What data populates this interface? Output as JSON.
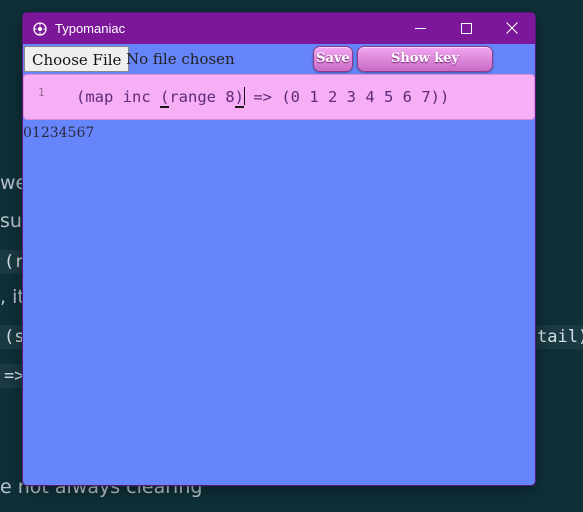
{
  "window": {
    "title": "Typomaniac",
    "controls": {
      "minimize_icon": "minimize-icon",
      "maximize_icon": "maximize-icon",
      "close_icon": "close-icon"
    }
  },
  "toolbar": {
    "file_button_label": "Choose File",
    "file_status": "No file chosen",
    "save_label": "Save",
    "keybindings_label": "Show key bindings"
  },
  "editor": {
    "line_number": "1",
    "code_before": "(map inc ",
    "open_paren": "(",
    "code_middle": "range 8",
    "close_paren": ")",
    "code_after": " => (0 1 2 3 4 5 6 7))"
  },
  "output": {
    "text": "01234567"
  },
  "background": {
    "frag1": "wel",
    "frag2": "su",
    "frag3": "(r",
    "frag4": ", it",
    "frag5": "(s",
    "frag6": "tail)",
    "frag7": "=>",
    "frag8": "e not always clearing"
  },
  "colors": {
    "titlebar": "#7d179a",
    "window_bg": "#6785fb",
    "editor_bg": "#f6aef5",
    "page_bg": "#0f3039"
  }
}
